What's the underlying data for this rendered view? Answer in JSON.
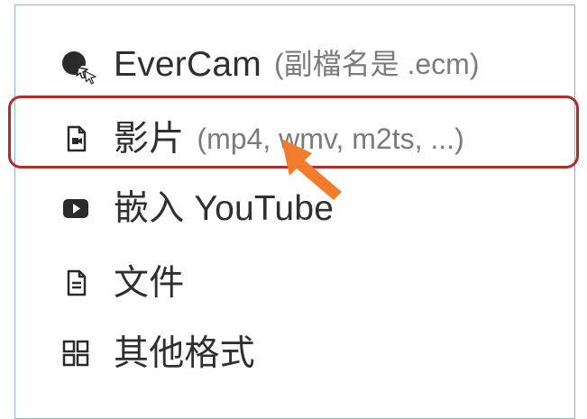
{
  "menu": {
    "items": [
      {
        "icon": "evercam-icon",
        "label": "EverCam",
        "hint": "(副檔名是 .ecm)"
      },
      {
        "icon": "video-file-icon",
        "label": "影片",
        "hint": "(mp4, wmv, m2ts, ...)"
      },
      {
        "icon": "youtube-icon",
        "label": "嵌入 YouTube",
        "hint": ""
      },
      {
        "icon": "document-icon",
        "label": "文件",
        "hint": ""
      },
      {
        "icon": "grid-icon",
        "label": "其他格式",
        "hint": ""
      }
    ]
  },
  "colors": {
    "highlight": "#b22a2a",
    "arrow": "#f07c2c",
    "icon": "#2a2a2a",
    "text": "#2f2f2f",
    "hint_text": "#7b7b7b"
  }
}
